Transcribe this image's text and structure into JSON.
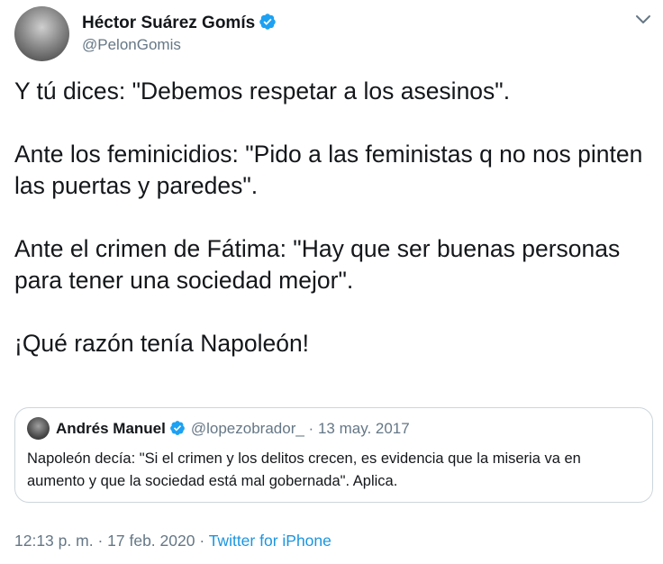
{
  "author": {
    "name": "Héctor Suárez Gomís",
    "handle": "@PelonGomis",
    "verified_icon": "verified-badge-icon"
  },
  "tweet": {
    "paragraphs": [
      "Y tú dices: \"Debemos respetar a los asesinos\".",
      "Ante los feminicidios: \"Pido a las feministas q no nos pinten las puertas y paredes\".",
      "Ante el crimen de Fátima: \"Hay que ser buenas personas para tener una sociedad mejor\".",
      "¡Qué razón tenía Napoleón!"
    ]
  },
  "quoted": {
    "name": "Andrés Manuel",
    "handle": "@lopezobrador_",
    "separator": "·",
    "date": "13 may. 2017",
    "text": "Napoleón decía: \"Si el crimen y los delitos crecen, es evidencia que la miseria va en aumento y que la sociedad está mal gobernada\". Aplica."
  },
  "meta": {
    "time": "12:13 p. m.",
    "separator": "·",
    "date": "17 feb. 2020",
    "separator2": "·",
    "source": "Twitter for iPhone"
  },
  "colors": {
    "accent": "#1b95e0",
    "secondary_text": "#657786",
    "border": "#ccd6dd",
    "verified": "#1da1f2"
  }
}
